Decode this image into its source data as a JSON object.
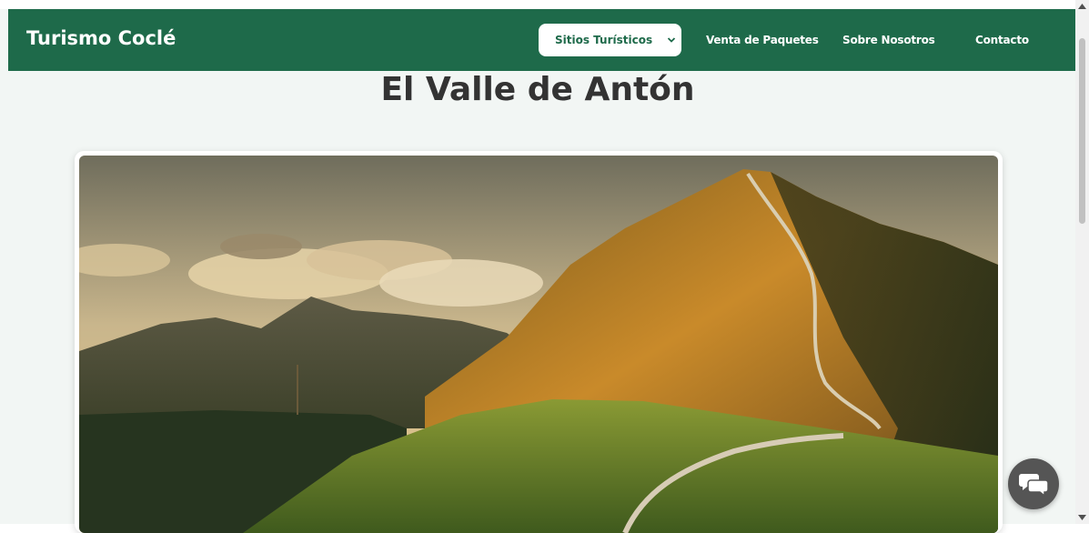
{
  "navbar": {
    "brand": "Turismo Coclé",
    "select": {
      "selected": "Sitios Turísticos"
    },
    "links": [
      "Venta de Paquetes",
      "Sobre Nosotros",
      "Contacto"
    ]
  },
  "main": {
    "title": "El Valle de Antón"
  },
  "icons": {
    "chevron": "chevron-down-icon",
    "chat": "chat-bubbles-icon"
  },
  "colors": {
    "navbar": "#1e6a4a",
    "background": "#f2f6f4",
    "title": "#333333",
    "chat_button": "#555555"
  }
}
